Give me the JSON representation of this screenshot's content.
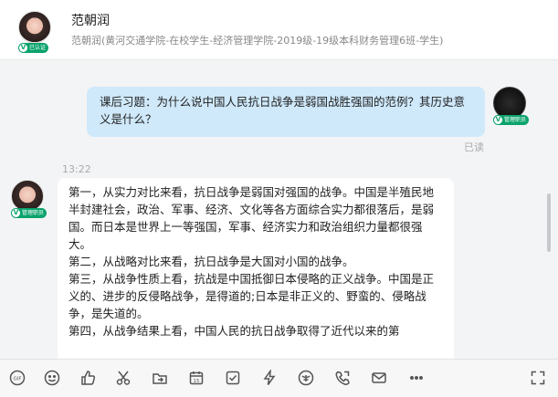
{
  "header": {
    "name": "范朝润",
    "subtitle": "范朝润(黄河交通学院-在校学生-经济管理学院-2019级-19级本科财务管理6班-学生)",
    "badge_text": "v 已认证"
  },
  "messages": {
    "outgoing": {
      "text": "课后习题：为什么说中国人民抗日战争是弱国战胜强国的范例？其历史意义是什么？",
      "status": "已读",
      "avatar_badge": "v 管理职员"
    },
    "time": "13:22",
    "incoming": {
      "avatar_badge": "v 管理职员",
      "lines": [
        "第一，从实力对比来看，抗日战争是弱国对强国的战争。中国是半殖民地半封建社会，政治、军事、经济、文化等各方面综合实力都很落后，是弱国。而日本是世界上一等强国，军事、经济实力和政治组织力量都很强大。",
        "第二，从战略对比来看，抗日战争是大国对小国的战争。",
        "第三，从战争性质上看，抗战是中国抵御日本侵略的正义战争。中国是正义的、进步的反侵略战争，是得道的;日本是非正义的、野蛮的、侵略战争，是失道的。",
        "第四，从战争结果上看，中国人民的抗日战争取得了近代以来的第"
      ]
    }
  },
  "toolbar": {
    "icons": [
      "gif-icon",
      "emoji-icon",
      "like-icon",
      "scissors-icon",
      "folder-transfer-icon",
      "calendar-icon",
      "checkbox-icon",
      "lightning-icon",
      "red-packet-icon",
      "call-icon",
      "mail-icon",
      "more-icon",
      "expand-icon"
    ],
    "calendar_day": "15",
    "gif_label": "GIF"
  },
  "colors": {
    "accent_green": "#0aa36c",
    "outgoing_bubble": "#cfe9fb",
    "incoming_bubble": "#ffffff",
    "background": "#f3f4f6"
  }
}
